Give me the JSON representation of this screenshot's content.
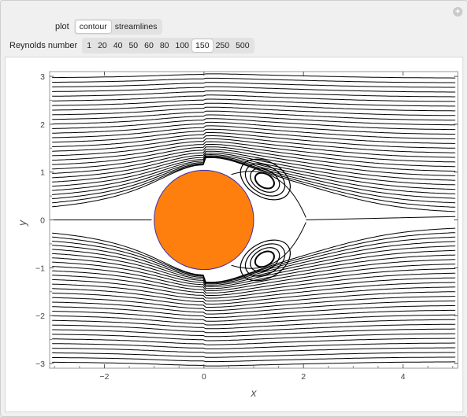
{
  "controls": {
    "plot_label": "plot",
    "plot_options": [
      "contour",
      "streamlines"
    ],
    "plot_selected": "contour",
    "reynolds_label": "Reynolds number",
    "reynolds_options": [
      "1",
      "20",
      "40",
      "50",
      "60",
      "80",
      "100",
      "150",
      "250",
      "500"
    ],
    "reynolds_selected": "150"
  },
  "icons": {
    "add": "plus-icon"
  },
  "chart_data": {
    "type": "contour",
    "xlabel": "x",
    "ylabel": "y",
    "xlim": [
      -3.1,
      5.1
    ],
    "ylim": [
      -3.1,
      3.1
    ],
    "x_ticks": [
      -2,
      0,
      2,
      4
    ],
    "y_ticks": [
      -3,
      -2,
      -1,
      0,
      1,
      2,
      3
    ],
    "x_tick_labels": [
      "−2",
      "0",
      "2",
      "4"
    ],
    "y_tick_labels": [
      "−3",
      "−2",
      "−1",
      "0",
      "1",
      "2",
      "3"
    ],
    "cylinder": {
      "center": [
        0,
        0
      ],
      "radius": 1,
      "fill": "#ff7f0e",
      "edge": "#3b2bb3"
    },
    "line_color": "#000000",
    "wake_vortices": [
      {
        "center": [
          1.22,
          0.82
        ]
      },
      {
        "center": [
          1.22,
          -0.82
        ]
      }
    ],
    "grid": false
  }
}
